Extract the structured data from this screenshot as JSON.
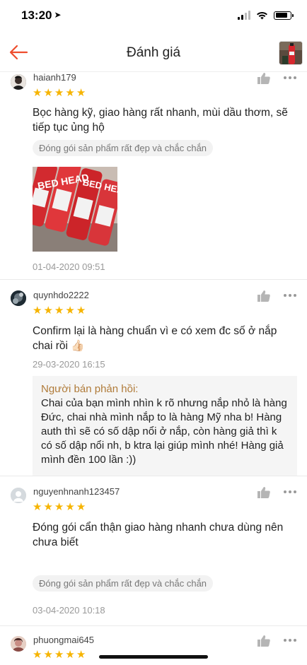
{
  "status": {
    "time": "13:20"
  },
  "nav": {
    "title": "Đánh giá"
  },
  "reviews": [
    {
      "username": "haianh179",
      "rating": 5,
      "comment": "Bọc hàng kỹ, giao hàng rất nhanh, mùi dầu thơm, sẽ tiếp tục ủng hộ",
      "tag": "Đóng gói sản phẩm rất đẹp và chắc chắn",
      "photo_label": "BED HEAD",
      "date": "01-04-2020 09:51"
    },
    {
      "username": "quynhdo2222",
      "rating": 5,
      "comment": "Confirm lại là hàng chuẩn vì e có xem đc số ở nắp chai rồi 👍🏻",
      "date": "29-03-2020 16:15",
      "seller_reply": {
        "title": "Người bán phản hồi:",
        "text": "Chai của bạn mình nhìn k rõ nhưng nắp nhỏ là hàng Đức, chai nhà mình nắp to là hàng Mỹ nha b! Hàng auth thì sẽ có số dập nổi ở nắp, còn hàng giả thì k có số dập nổi nh, b ktra lại giúp mình nhé! Hàng giả mình đền 100 lần :))"
      }
    },
    {
      "username": "nguyenhnanh123457",
      "rating": 5,
      "comment": "Đóng gói cẩn thận giao hàng nhanh chưa dùng nên chưa biết",
      "tag": "Đóng gói sản phẩm rất đẹp và chắc chắn",
      "date": "03-04-2020 10:18"
    },
    {
      "username": "phuongmai645",
      "rating": 5
    }
  ],
  "icons": {
    "back": "arrow-left-icon",
    "like": "thumbs-up-icon",
    "more": "more-horizontal-icon",
    "star": "star-icon"
  },
  "colors": {
    "accent": "#ee4d2d",
    "star": "#f6b400",
    "seller_title": "#b07b39"
  }
}
